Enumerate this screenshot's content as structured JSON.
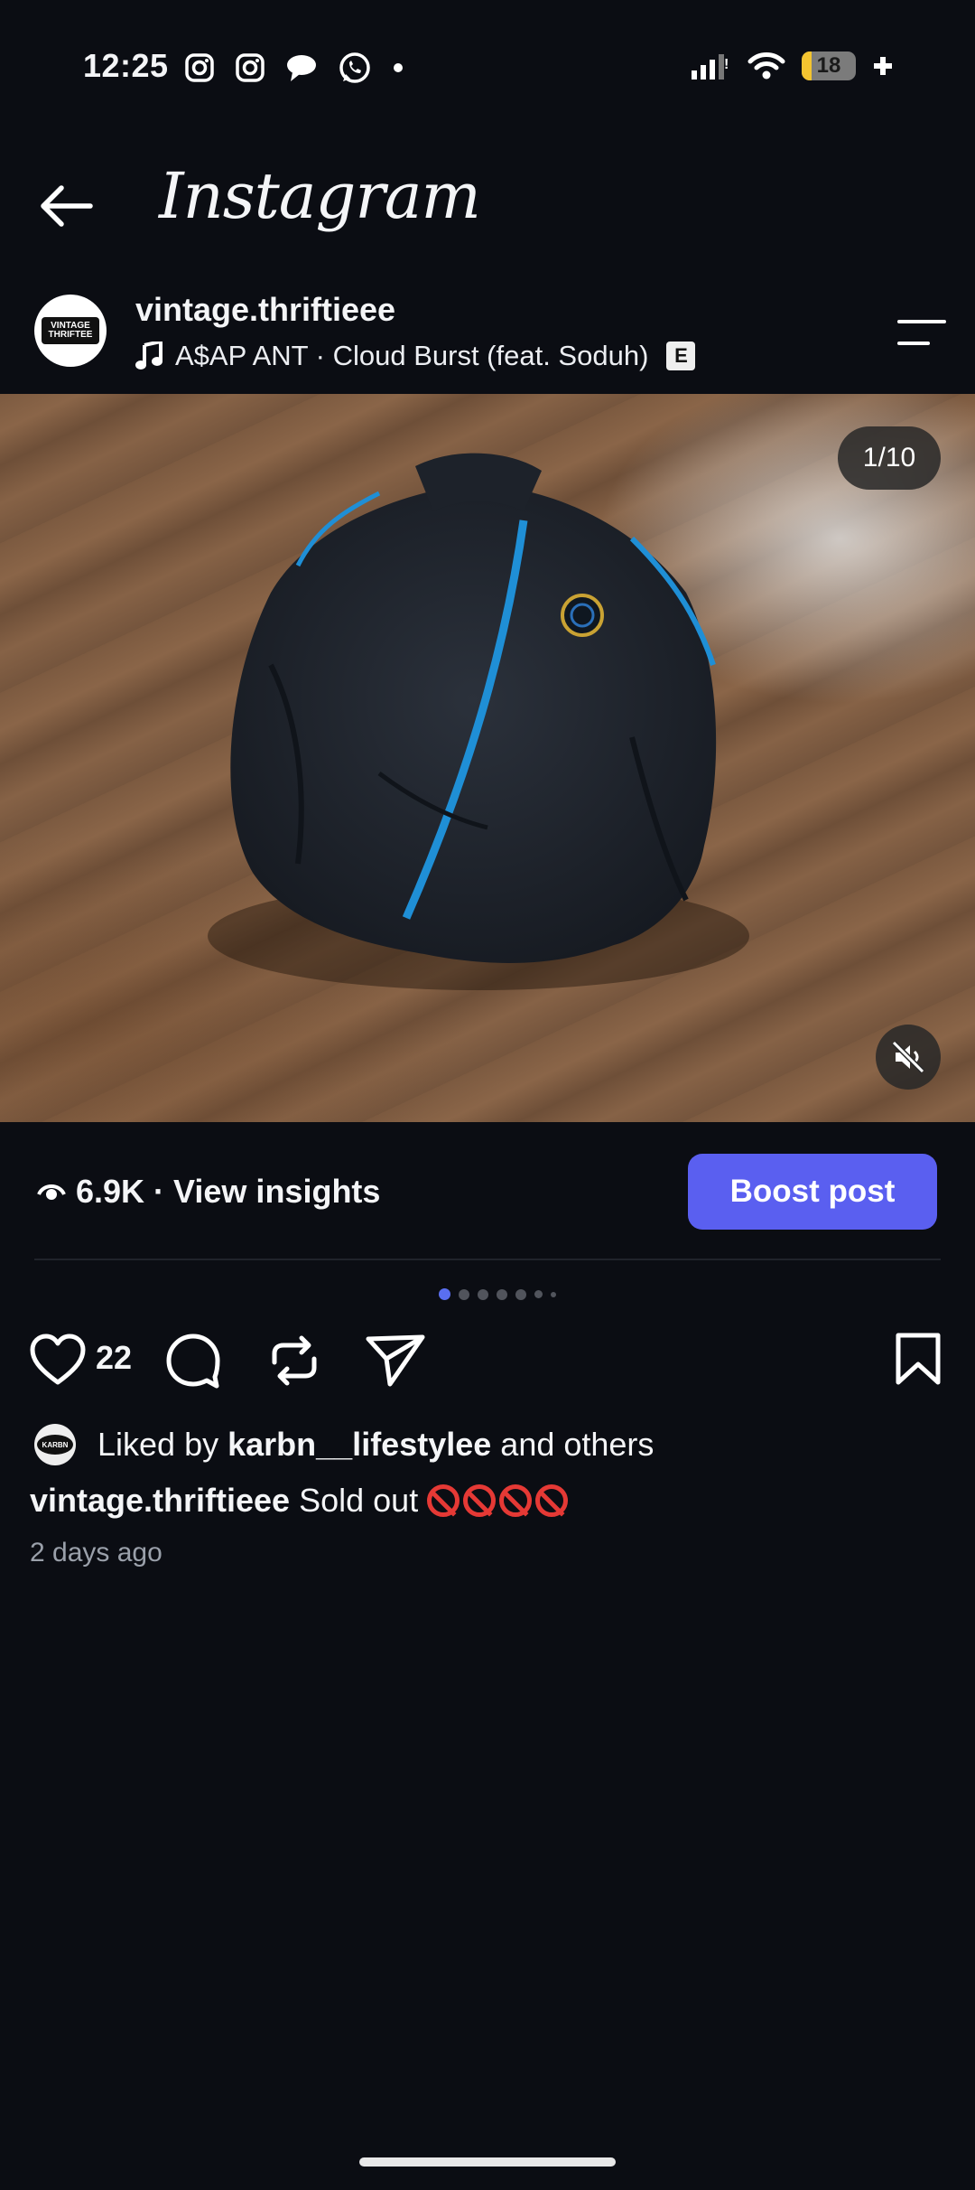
{
  "status_bar": {
    "time": "12:25",
    "battery_level": "18",
    "battery_fraction": 0.18,
    "notification_icons": [
      "instagram-icon",
      "instagram-icon",
      "chat-bubble-icon",
      "whatsapp-icon",
      "dot-icon"
    ]
  },
  "header": {
    "title": "Instagram"
  },
  "post": {
    "username": "vintage.thriftieee",
    "avatar_text": "VINTAGE THRIFTEE",
    "audio": "A$AP ANT · Cloud Burst (feat. Soduh)",
    "explicit_badge": "E",
    "media_counter": "1/10",
    "views": "6.9K",
    "separator": "·",
    "view_insights": "View insights",
    "boost_label": "Boost post",
    "like_count": "22",
    "liked_by_prefix": "Liked by",
    "liked_by_user": "karbn__lifestylee",
    "liked_by_suffix": "and others",
    "liked_avatar_text": "KARBN",
    "caption_user": "vintage.thriftieee",
    "caption_text": "Sold out",
    "time_ago": "2 days ago"
  },
  "carousel": {
    "total_dots": 7,
    "active_index": 0
  },
  "colors": {
    "background": "#0b0d13",
    "accent": "#5a5ff0",
    "muted_text": "#9aa0aa",
    "prohibited_emoji": "#e53935"
  }
}
